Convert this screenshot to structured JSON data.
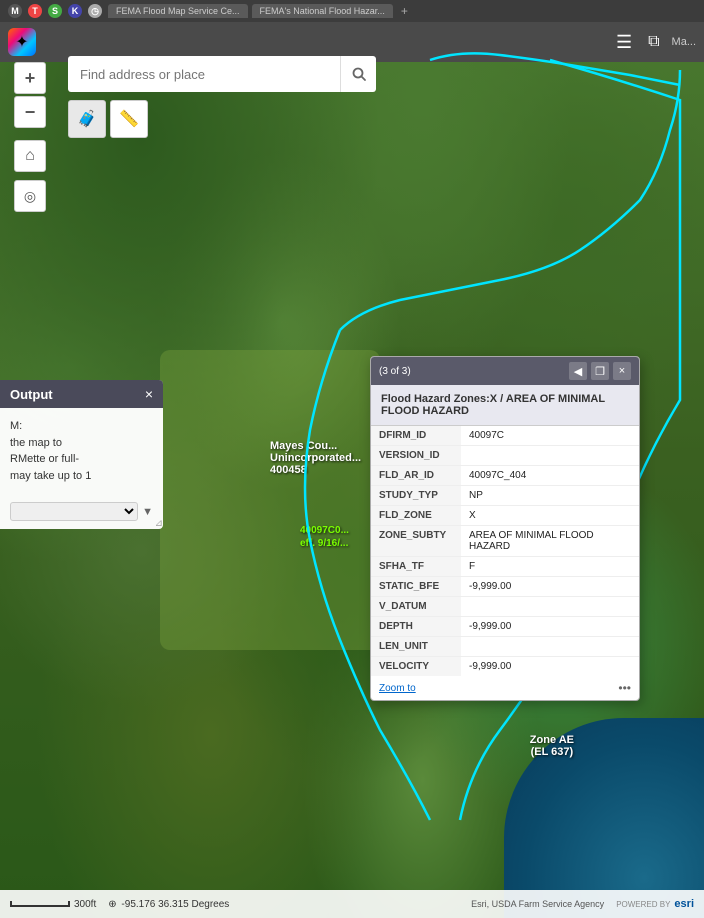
{
  "browser": {
    "tabs": [
      {
        "label": "FEMA Flood Map Service Ce..."
      },
      {
        "label": "FEMA's National Flood Hazar..."
      }
    ],
    "plus_label": "+"
  },
  "toolbar": {
    "hamburger_label": "☰",
    "layers_label": "⧉",
    "map_label": "Ma..."
  },
  "search": {
    "placeholder": "Find address or place",
    "value": ""
  },
  "map_controls": {
    "zoom_in": "+",
    "zoom_out": "−",
    "home": "⌂",
    "locate": "◎"
  },
  "tools": {
    "briefcase_unicode": "💼",
    "ruler_unicode": "📏"
  },
  "side_panel": {
    "title": "Output",
    "close_label": "×",
    "label_em": "M:",
    "hint1": "the map to",
    "hint2": "RMette or full-",
    "hint3": "may take up to 1",
    "select_placeholder": ""
  },
  "map_labels": {
    "county_line": "Mayes Cou...",
    "unincorporated": "Unincorporated...",
    "parcel_id": "400458",
    "green_label_1": "40097C0...",
    "green_label_2": "eff. 9/16/...",
    "zone_ae": "Zone AE",
    "zone_ae_el": "(EL 637)"
  },
  "popup": {
    "counter": "(3 of 3)",
    "prev_label": "◀",
    "restore_label": "❐",
    "close_label": "×",
    "title": "Flood Hazard Zones:X / AREA OF MINIMAL FLOOD HAZARD",
    "fields": [
      {
        "key": "DFIRM_ID",
        "value": "40097C"
      },
      {
        "key": "VERSION_ID",
        "value": ""
      },
      {
        "key": "FLD_AR_ID",
        "value": "40097C_404"
      },
      {
        "key": "STUDY_TYP",
        "value": "NP"
      },
      {
        "key": "FLD_ZONE",
        "value": "X"
      },
      {
        "key": "ZONE_SUBTY",
        "value": "AREA OF MINIMAL FLOOD HAZARD"
      },
      {
        "key": "SFHA_TF",
        "value": "F"
      },
      {
        "key": "STATIC_BFE",
        "value": "-9,999.00"
      },
      {
        "key": "V_DATUM",
        "value": ""
      },
      {
        "key": "DEPTH",
        "value": "-9,999.00"
      },
      {
        "key": "LEN_UNIT",
        "value": ""
      },
      {
        "key": "VELOCITY",
        "value": "-9,999.00"
      }
    ],
    "zoom_to_label": "Zoom to",
    "more_label": "•••"
  },
  "bottom_bar": {
    "scale_text": "300ft",
    "coords": "-95.176 36.315 Degrees",
    "attribution": "Esri, USDA Farm Service Agency",
    "powered_by": "POWERED BY",
    "esri_label": "esri"
  }
}
